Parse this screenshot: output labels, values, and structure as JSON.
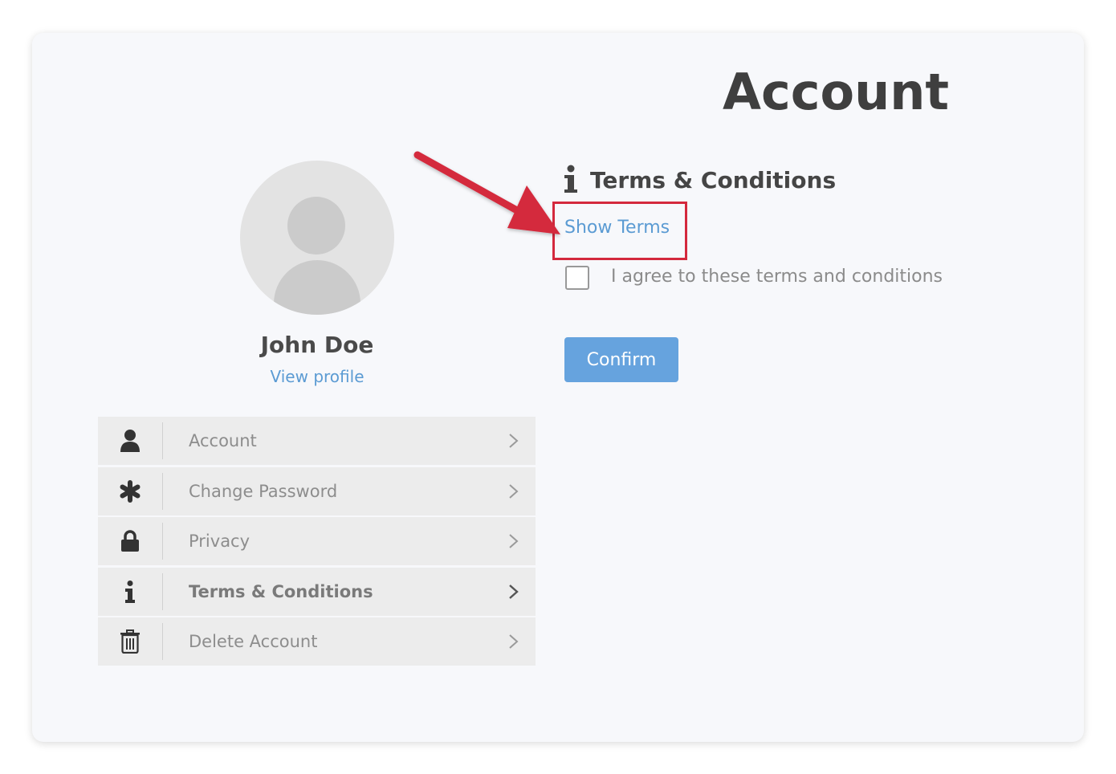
{
  "page": {
    "title": "Account"
  },
  "profile": {
    "name": "John Doe",
    "view_profile_label": "View profile"
  },
  "menu": {
    "items": [
      {
        "label": "Account",
        "icon": "user-icon"
      },
      {
        "label": "Change Password",
        "icon": "asterisk-icon"
      },
      {
        "label": "Privacy",
        "icon": "lock-icon"
      },
      {
        "label": "Terms & Conditions",
        "icon": "info-icon",
        "active": true
      },
      {
        "label": "Delete Account",
        "icon": "trash-icon"
      }
    ]
  },
  "terms": {
    "title": "Terms & Conditions",
    "show_terms_label": "Show Terms",
    "agree_label": "I agree to these terms and conditions",
    "agree_checked": false,
    "confirm_label": "Confirm"
  },
  "colors": {
    "link": "#5b9bd3",
    "button": "#66a3de",
    "highlight": "#d4293d"
  }
}
